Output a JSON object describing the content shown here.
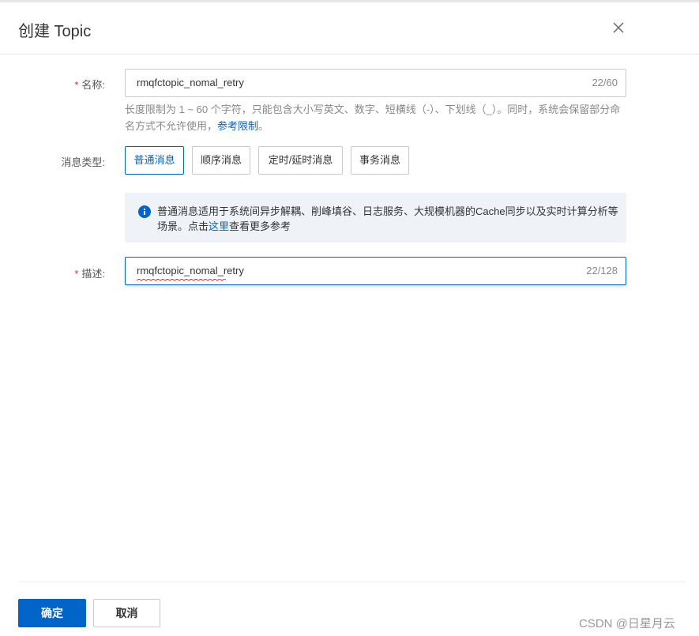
{
  "dialog": {
    "title": "创建 Topic"
  },
  "form": {
    "name": {
      "label": "名称:",
      "value": "rmqfctopic_nomal_retry",
      "counter": "22/60",
      "help_text": "长度限制为 1 ~ 60 个字符，只能包含大小写英文、数字、短横线（-）、下划线（_）。同时，系统会保留部分命名方式不允许使用，",
      "help_link": "参考限制",
      "help_end": "。"
    },
    "message_type": {
      "label": "消息类型:",
      "options": [
        "普通消息",
        "顺序消息",
        "定时/延时消息",
        "事务消息"
      ],
      "selected": "普通消息"
    },
    "notice": {
      "text_before": "普通消息适用于系统间异步解耦、削峰填谷、日志服务、大规模机器的Cache同步以及实时计算分析等场景。点击",
      "link": "这里",
      "text_after": "查看更多参考"
    },
    "description": {
      "label": "描述:",
      "value": "rmqfctopic_nomal_retry",
      "counter": "22/128"
    }
  },
  "footer": {
    "confirm_label": "确定",
    "cancel_label": "取消"
  },
  "watermark": "CSDN @日星月云",
  "colors": {
    "primary": "#0064c8",
    "required": "#d93026",
    "notice_bg": "#eff3f8"
  },
  "icons": {
    "close": "close-icon",
    "info": "info-icon"
  }
}
